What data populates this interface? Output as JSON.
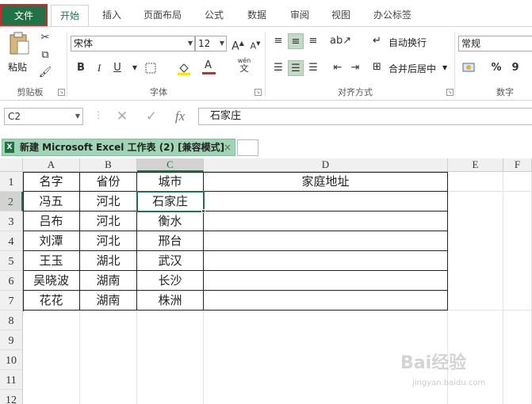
{
  "ribbon_tabs": [
    "文件",
    "开始",
    "插入",
    "页面布局",
    "公式",
    "数据",
    "审阅",
    "视图",
    "办公标签"
  ],
  "clipboard": {
    "paste_label": "粘贴",
    "group_label": "剪贴板"
  },
  "font": {
    "name": "宋体",
    "size": "12",
    "group_label": "字体",
    "bold": "B",
    "italic": "I",
    "underline": "U",
    "font_color_letter": "A",
    "wen_label": "wén",
    "wen_char": "文"
  },
  "alignment": {
    "wrap_text": "自动换行",
    "merge_center": "合并后居中",
    "group_label": "对齐方式"
  },
  "number": {
    "format": "常规",
    "percent": "%",
    "comma": "9",
    "group_label": "数字"
  },
  "formula_bar": {
    "name_box": "C2",
    "fx": "fx",
    "value": "石家庄"
  },
  "workbook": {
    "tab_title": "新建 Microsoft Excel 工作表 (2)  [兼容模式]",
    "close": "×"
  },
  "columns": [
    "A",
    "B",
    "C",
    "D",
    "E",
    "F"
  ],
  "rows": [
    "1",
    "2",
    "3",
    "4",
    "5",
    "6",
    "7",
    "8",
    "9",
    "10",
    "11",
    "12"
  ],
  "table": {
    "header": [
      "名字",
      "省份",
      "城市",
      "家庭地址"
    ],
    "rows": [
      [
        "冯五",
        "河北",
        "石家庄",
        ""
      ],
      [
        "吕布",
        "河北",
        "衡水",
        ""
      ],
      [
        "刘潭",
        "河北",
        "邢台",
        ""
      ],
      [
        "王玉",
        "湖北",
        "武汉",
        ""
      ],
      [
        "吴晓波",
        "湖南",
        "长沙",
        ""
      ],
      [
        "花花",
        "湖南",
        "株洲",
        ""
      ]
    ]
  },
  "watermark": {
    "main": "Bai经验",
    "sub": "jingyan.baidu.com"
  },
  "colors": {
    "accent": "#217346",
    "file_border": "#d6262b",
    "wb_tab": "#9fd5b5"
  }
}
